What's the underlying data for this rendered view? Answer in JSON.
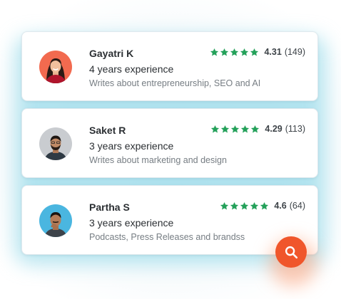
{
  "writers": [
    {
      "name": "Gayatri K",
      "experience": "4 years experience",
      "description": "Writes about entrepreneurship, SEO and AI",
      "rating": "4.31",
      "reviews": "(149)",
      "stars": 5
    },
    {
      "name": "Saket R",
      "experience": "3 years experience",
      "description": "Writes about marketing and design",
      "rating": "4.29",
      "reviews": "(113)",
      "stars": 5
    },
    {
      "name": "Partha S",
      "experience": "3 years experience",
      "description": "Podcasts, Press Releases and brandss",
      "rating": "4.6",
      "reviews": "(64)",
      "stars": 5
    }
  ],
  "colors": {
    "star_green": "#24a15a",
    "search_orange": "#f0562b",
    "card_glow": "#78d0e4",
    "avatar1_bg": "#f26a4f",
    "avatar2_bg": "#c9ccd0",
    "avatar3_bg": "#4ab6e0"
  },
  "icons": {
    "star": "star-icon",
    "search": "search-icon"
  }
}
